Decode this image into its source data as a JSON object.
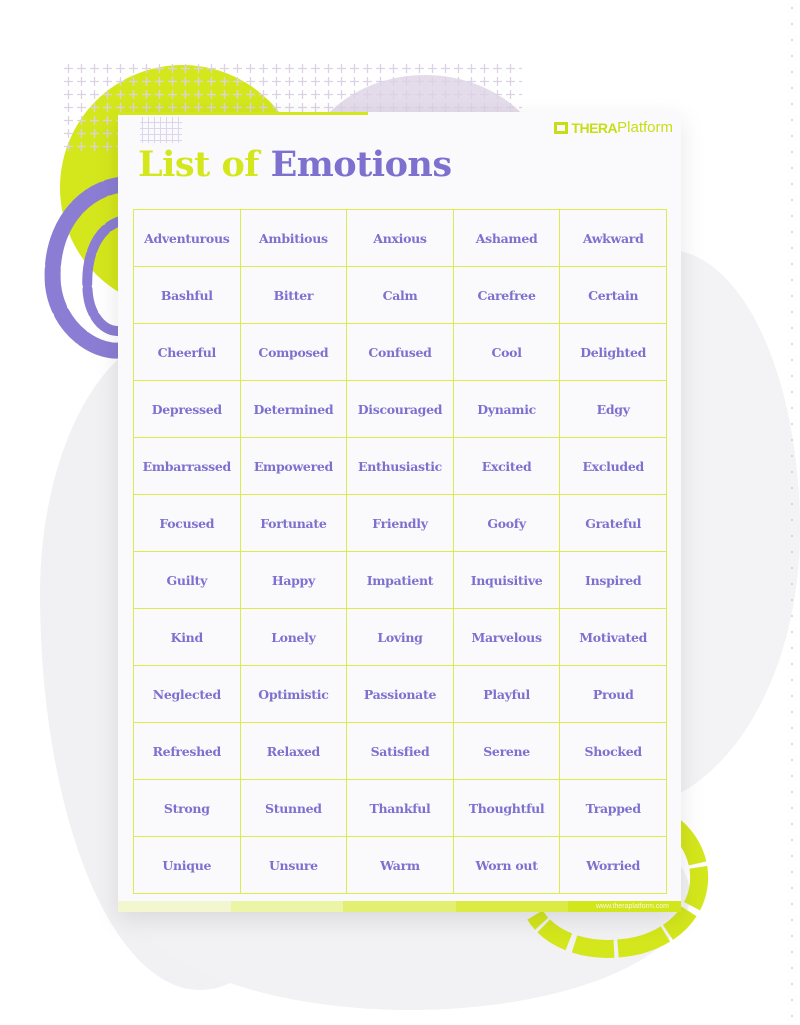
{
  "document": {
    "title_part1": "List of",
    "title_part2": "Emotions",
    "logo": {
      "icon": "speech-bubble-icon",
      "bold": "THERA",
      "light": "Platform"
    },
    "footer_url": "www.theraplatform.com",
    "colors": {
      "lime": "#d4e71c",
      "purple": "#7d70cf",
      "grid_border": "#dcec4c"
    }
  },
  "emotions": [
    [
      "Adventurous",
      "Ambitious",
      "Anxious",
      "Ashamed",
      "Awkward"
    ],
    [
      "Bashful",
      "Bitter",
      "Calm",
      "Carefree",
      "Certain"
    ],
    [
      "Cheerful",
      "Composed",
      "Confused",
      "Cool",
      "Delighted"
    ],
    [
      "Depressed",
      "Determined",
      "Discouraged",
      "Dynamic",
      "Edgy"
    ],
    [
      "Embarrassed",
      "Empowered",
      "Enthusiastic",
      "Excited",
      "Excluded"
    ],
    [
      "Focused",
      "Fortunate",
      "Friendly",
      "Goofy",
      "Grateful"
    ],
    [
      "Guilty",
      "Happy",
      "Impatient",
      "Inquisitive",
      "Inspired"
    ],
    [
      "Kind",
      "Lonely",
      "Loving",
      "Marvelous",
      "Motivated"
    ],
    [
      "Neglected",
      "Optimistic",
      "Passionate",
      "Playful",
      "Proud"
    ],
    [
      "Refreshed",
      "Relaxed",
      "Satisfied",
      "Serene",
      "Shocked"
    ],
    [
      "Strong",
      "Stunned",
      "Thankful",
      "Thoughtful",
      "Trapped"
    ],
    [
      "Unique",
      "Unsure",
      "Warm",
      "Worn out",
      "Worried"
    ]
  ]
}
